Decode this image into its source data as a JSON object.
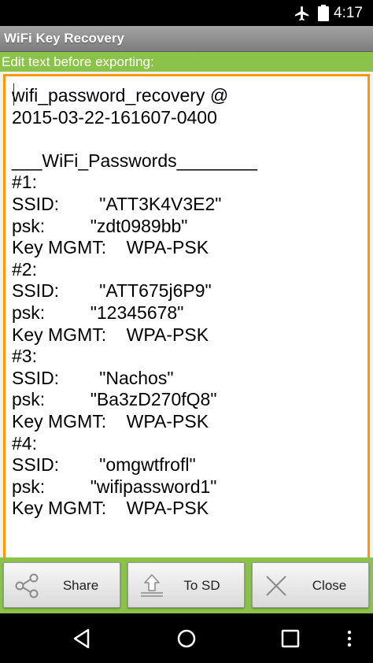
{
  "status_bar": {
    "time": "4:17",
    "icons": [
      "airplane-mode-icon",
      "battery-icon"
    ]
  },
  "app": {
    "title": "WiFi Key Recovery",
    "hint": "Edit text before exporting:"
  },
  "editor": {
    "text": "wifi_password_recovery @\n2015-03-22-161607-0400\n\n___WiFi_Passwords________\n#1:\nSSID:        \"ATT3K4V3E2\"\npsk:         \"zdt0989bb\"\nKey MGMT:    WPA-PSK\n#2:\nSSID:        \"ATT675j6P9\"\npsk:         \"12345678\"\nKey MGMT:    WPA-PSK\n#3:\nSSID:        \"Nachos\"\npsk:         \"Ba3zD270fQ8\"\nKey MGMT:    WPA-PSK\n#4:\nSSID:        \"omgwtfrofl\"\npsk:         \"wifipassword1\"\nKey MGMT:    WPA-PSK"
  },
  "buttons": {
    "share": "Share",
    "to_sd": "To SD",
    "close": "Close"
  },
  "navigation": {
    "items": [
      "back-icon",
      "home-icon",
      "recents-icon",
      "more-icon"
    ]
  },
  "colors": {
    "accent_green": "#8bc34a",
    "focus_orange": "#ff9800",
    "title_gray": "#8f8f8f"
  }
}
